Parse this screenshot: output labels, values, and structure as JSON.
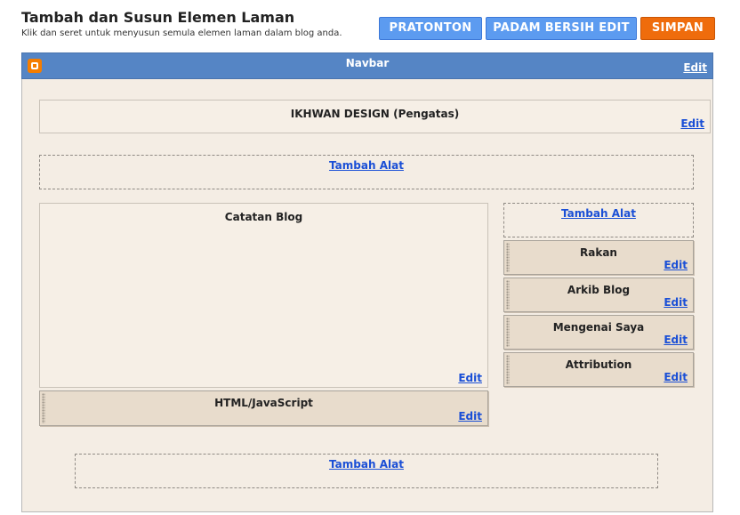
{
  "header": {
    "title": "Tambah dan Susun Elemen Laman",
    "subtitle": "Klik dan seret untuk menyusun semula elemen laman dalam blog anda."
  },
  "buttons": {
    "preview": "PRATONTON",
    "clear": "PADAM BERSIH EDIT",
    "save": "SIMPAN"
  },
  "navbar": {
    "title": "Navbar",
    "edit": "Edit"
  },
  "header_widget": {
    "title": "IKHWAN DESIGN (Pengatas)",
    "edit": "Edit"
  },
  "add_gadget_label": "Tambah Alat",
  "main": {
    "blog_posts": {
      "title": "Catatan Blog",
      "edit": "Edit"
    },
    "html_js": {
      "title": "HTML/JavaScript",
      "edit": "Edit"
    }
  },
  "sidebar": {
    "widgets": [
      {
        "title": "Rakan",
        "edit": "Edit"
      },
      {
        "title": "Arkib Blog",
        "edit": "Edit"
      },
      {
        "title": "Mengenai Saya",
        "edit": "Edit"
      },
      {
        "title": "Attribution",
        "edit": "Edit"
      }
    ]
  },
  "colors": {
    "accent_blue": "#5c9bf0",
    "save_orange": "#ef6c0c",
    "navbar_blue": "#5585c5",
    "link_blue": "#1a4fd6",
    "canvas_bg": "#f4ede4"
  },
  "icons": {
    "navbar_logo": "blogger-icon"
  }
}
